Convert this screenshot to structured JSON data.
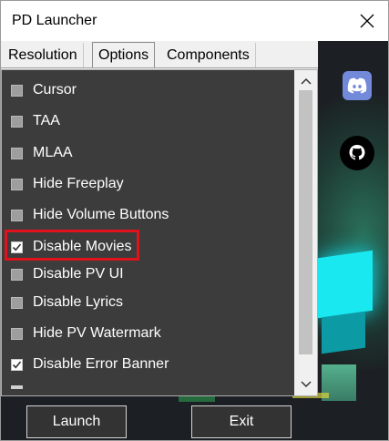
{
  "window": {
    "title": "PD Launcher"
  },
  "tabs": [
    {
      "label": "Resolution",
      "active": false
    },
    {
      "label": "Options",
      "active": true
    },
    {
      "label": "Components",
      "active": false
    }
  ],
  "options": [
    {
      "label": "Cursor",
      "checked": false
    },
    {
      "label": "TAA",
      "checked": false
    },
    {
      "label": "MLAA",
      "checked": false
    },
    {
      "label": "Hide Freeplay",
      "checked": false
    },
    {
      "label": "Hide Volume Buttons",
      "checked": false
    },
    {
      "label": "Disable Movies",
      "checked": true,
      "highlighted": true
    },
    {
      "label": "Disable PV UI",
      "checked": false
    },
    {
      "label": "Disable Lyrics",
      "checked": false
    },
    {
      "label": "Hide PV Watermark",
      "checked": false
    },
    {
      "label": "Disable Error Banner",
      "checked": true
    }
  ],
  "buttons": {
    "launch": "Launch",
    "exit": "Exit"
  },
  "icons": {
    "discord": "discord-icon",
    "github": "github-icon",
    "close": "close-icon"
  },
  "colors": {
    "highlight": "#e0121b",
    "panel": "#3c3c3c",
    "discord": "#7389da"
  }
}
